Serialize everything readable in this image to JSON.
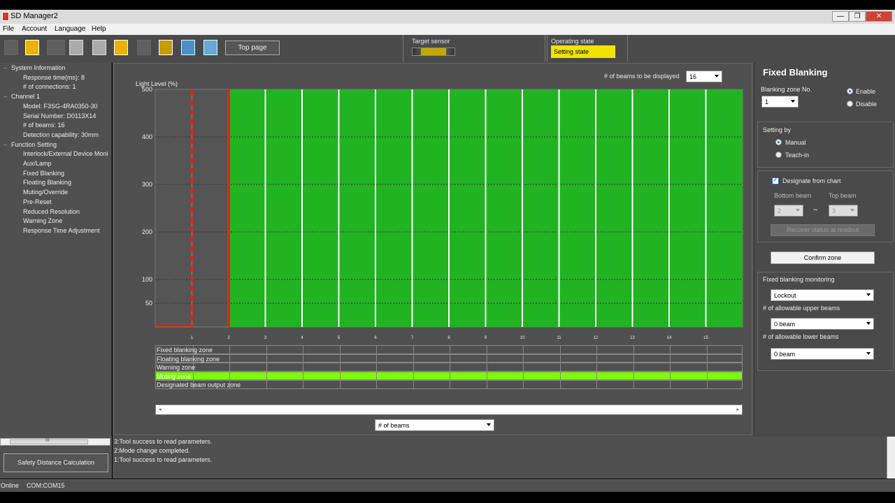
{
  "window": {
    "title": "SD Manager2",
    "minimize": "—",
    "maximize": "❐",
    "close": "✕"
  },
  "menu": [
    "File",
    "Account",
    "Language",
    "Help"
  ],
  "toolbar": {
    "top_page": "Top page"
  },
  "target_sensor": {
    "label": "Target sensor"
  },
  "operating_state": {
    "label": "Operating state",
    "value": "Setting state"
  },
  "tree": [
    {
      "text": "System Information",
      "level": 0
    },
    {
      "text": "Response time(ms): 8",
      "level": 1
    },
    {
      "text": "# of connections: 1",
      "level": 1
    },
    {
      "text": "Channel 1",
      "level": 0
    },
    {
      "text": "Model: F3SG-4RA0350-30",
      "level": 1
    },
    {
      "text": "Serial Number: D0113X14",
      "level": 1
    },
    {
      "text": "# of beams: 16",
      "level": 1
    },
    {
      "text": "Detection capability: 30mm",
      "level": 1
    },
    {
      "text": "Function Setting",
      "level": 0
    },
    {
      "text": "Interlock/External Device Moni",
      "level": 1
    },
    {
      "text": "Aux/Lamp",
      "level": 1
    },
    {
      "text": "Fixed Blanking",
      "level": 1
    },
    {
      "text": "Floating Blanking",
      "level": 1
    },
    {
      "text": "Muting/Override",
      "level": 1
    },
    {
      "text": "Pre-Reset",
      "level": 1
    },
    {
      "text": "Reduced Resolution",
      "level": 1
    },
    {
      "text": "Warning Zone",
      "level": 1
    },
    {
      "text": "Response Time Adjustment",
      "level": 1
    }
  ],
  "chart_controls": {
    "beams_label": "# of beams to be displayed",
    "beams_value": "16",
    "x_axis_select": "# of beams"
  },
  "chart_data": {
    "type": "bar",
    "ylabel": "Light Level (%)",
    "ylim": [
      0,
      500
    ],
    "yticks": [
      50,
      100,
      200,
      300,
      400,
      500
    ],
    "x_ticks": [
      "1",
      "2",
      "3",
      "4",
      "5",
      "6",
      "7",
      "8",
      "9",
      "10",
      "11",
      "12",
      "13",
      "14",
      "15"
    ],
    "beams": [
      1,
      2,
      3,
      4,
      5,
      6,
      7,
      8,
      9,
      10,
      11,
      12,
      13,
      14,
      15,
      16
    ],
    "values": [
      0,
      0,
      500,
      500,
      500,
      500,
      500,
      500,
      500,
      500,
      500,
      500,
      500,
      500,
      500,
      500
    ],
    "blanked_beams": [
      2
    ],
    "colors": {
      "bar": "#22b322",
      "blank_marker": "#e0231b",
      "plot_bg": "#555555"
    }
  },
  "zones": [
    {
      "label": "Fixed blanking zone",
      "highlight": false
    },
    {
      "label": "Floating blanking zone",
      "highlight": false
    },
    {
      "label": "Warning zone",
      "highlight": false
    },
    {
      "label": "Muting zone",
      "highlight": true
    },
    {
      "label": "Designated beam output zone",
      "highlight": false
    }
  ],
  "right": {
    "title": "Fixed Blanking",
    "zone_no_label": "Blanking zone No.",
    "zone_no_value": "1",
    "enable": "Enable",
    "disable": "Disable",
    "setting_by": "Setting by",
    "manual": "Manual",
    "teach_in": "Teach-in",
    "designate": "Designate from chart",
    "bottom_beam": "Bottom beam",
    "top_beam": "Top beam",
    "bottom_value": "2",
    "top_value": "3",
    "tilde": "~",
    "recover": "Recover status at readout",
    "confirm": "Confirm zone",
    "monitoring": "Fixed blanking monitoring",
    "monitoring_value": "Lockout",
    "upper_label": "# of allowable upper beams",
    "upper_value": "0 beam",
    "lower_label": "# of allowable lower beams",
    "lower_value": "0 beam"
  },
  "log": [
    "3:Tool success to read parameters.",
    "2:Mode change completed.",
    "1:Tool success to read parameters."
  ],
  "bottom": {
    "safety_btn": "Safety Distance Calculation",
    "scroll_grip": "III"
  },
  "status": {
    "online": "Online",
    "port": "COM:COM15"
  }
}
